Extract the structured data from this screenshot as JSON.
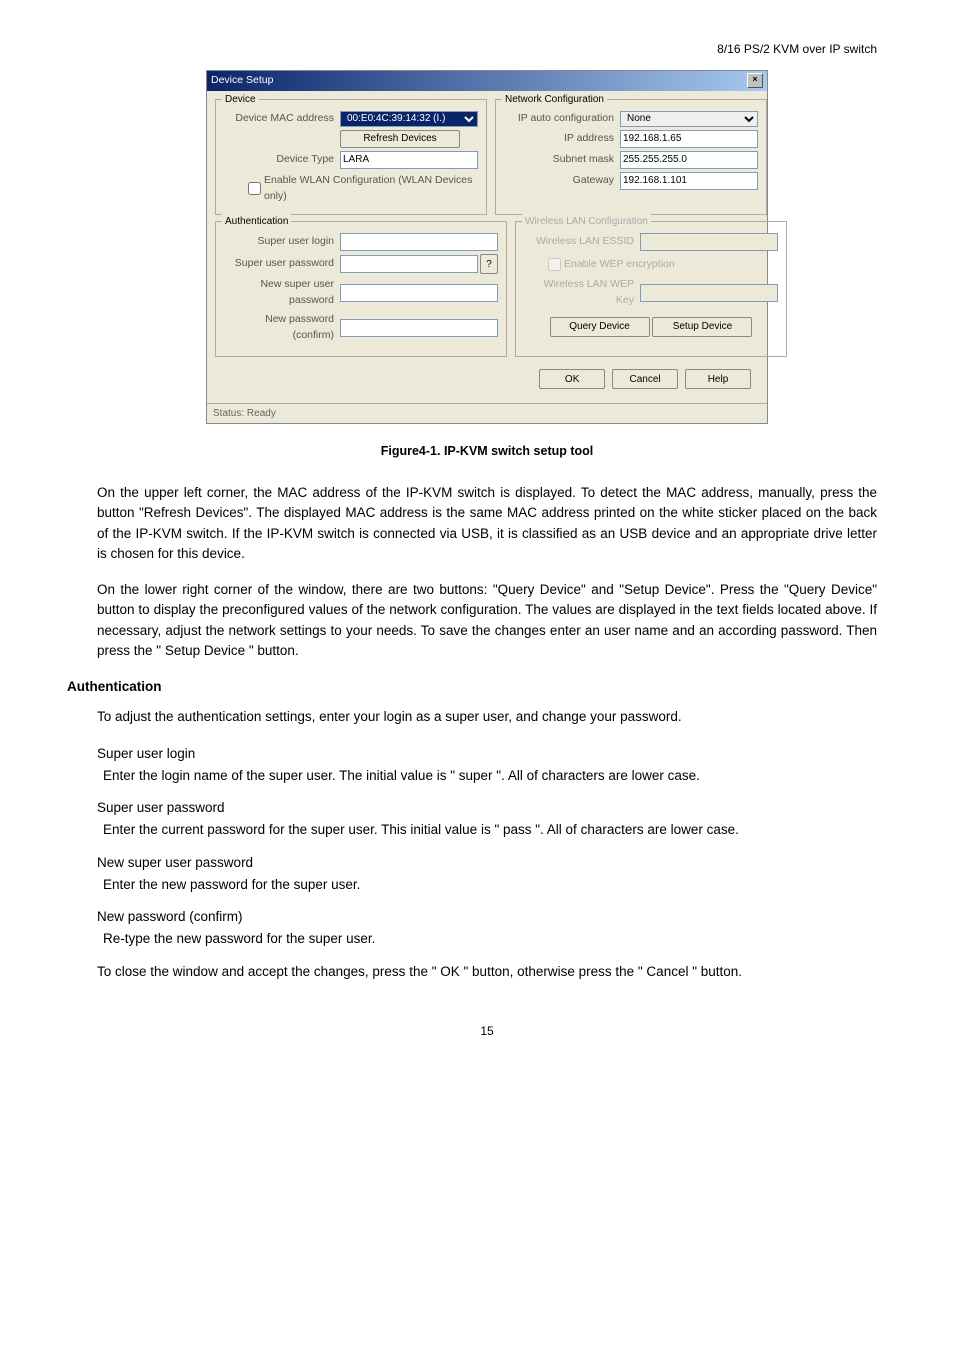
{
  "header": {
    "product": "8/16 PS/2 KVM over IP switch"
  },
  "dialog": {
    "title": "Device Setup",
    "close_glyph": "×",
    "device_group": {
      "title": "Device",
      "mac_label": "Device MAC address",
      "mac_value": "00:E0:4C:39:14:32 (I.)",
      "refresh_btn": "Refresh Devices",
      "type_label": "Device Type",
      "type_value": "LARA",
      "wlan_cfg_chk": "Enable WLAN Configuration (WLAN Devices only)"
    },
    "net_group": {
      "title": "Network Configuration",
      "auto_label": "IP auto configuration",
      "auto_value": "None",
      "ip_label": "IP address",
      "ip_value": "192.168.1.65",
      "mask_label": "Subnet mask",
      "mask_value": "255.255.255.0",
      "gw_label": "Gateway",
      "gw_value": "192.168.1.101"
    },
    "auth_group": {
      "title": "Authentication",
      "su_login_label": "Super user login",
      "su_pw_label": "Super user password",
      "su_pw_btn": "?",
      "new_pw_label": "New super user password",
      "new_pw2_label": "New password (confirm)"
    },
    "wlan_group": {
      "title": "Wireless LAN Configuration",
      "essid_label": "Wireless LAN ESSID",
      "wep_chk": "Enable WEP encryption",
      "wep_key_label": "Wireless LAN WEP Key",
      "query_btn": "Query Device",
      "setup_btn": "Setup Device"
    },
    "bottom": {
      "ok": "OK",
      "cancel": "Cancel",
      "help": "Help"
    },
    "status": "Status: Ready"
  },
  "caption": "Figure4-1. IP-KVM switch setup tool",
  "para1": "On the upper left corner, the MAC address of the IP-KVM switch is displayed. To detect the MAC address, manually, press the button \"Refresh Devices\". The displayed MAC address is the same MAC address printed on the white sticker placed on the back of the IP-KVM switch. If the IP-KVM switch is connected via USB, it is classified as an USB device and an appropriate drive letter is chosen for this device.",
  "para2": "On the lower right corner of the window, there are two buttons: \"Query Device\" and \"Setup Device\". Press the \"Query Device\" button to display the preconfigured values of the network configuration. The values are displayed in the text fields located above. If necessary, adjust the network settings to your needs. To save the changes enter an user name and an according password. Then press the \" Setup Device \" button.",
  "auth_heading": "Authentication",
  "para3": "To adjust the authentication settings, enter your login as a super user, and change your password.",
  "defs": {
    "t1": "Super user login",
    "d1": "Enter the login name of the super user. The initial value is \" super \". All of characters are lower case.",
    "t2": "Super user password",
    "d2": "Enter the current password for the super user. This initial value is \" pass \". All of characters are lower case.",
    "t3": "New super user password",
    "d3": "Enter the new password for the super user.",
    "t4": "New password (confirm)",
    "d4": "Re-type the new password for the super user."
  },
  "para4": "To close the window and accept the changes, press the \" OK \" button, otherwise press the \" Cancel \" button.",
  "pagenum": "15"
}
